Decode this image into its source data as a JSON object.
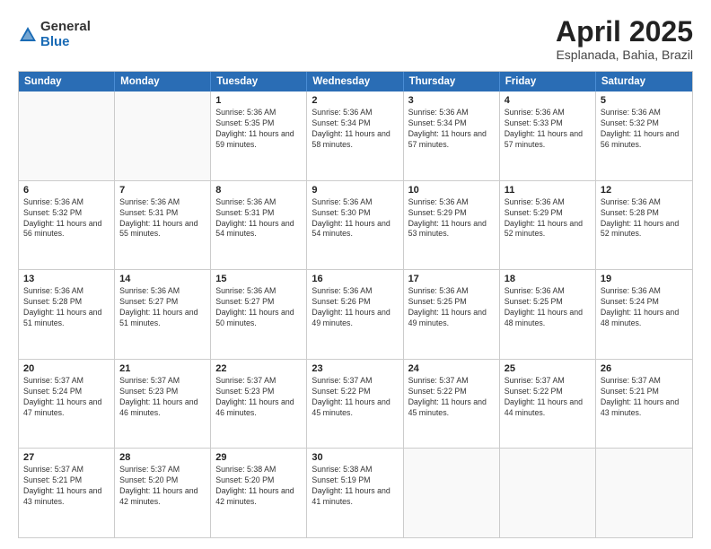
{
  "logo": {
    "general": "General",
    "blue": "Blue"
  },
  "title": "April 2025",
  "location": "Esplanada, Bahia, Brazil",
  "days": [
    "Sunday",
    "Monday",
    "Tuesday",
    "Wednesday",
    "Thursday",
    "Friday",
    "Saturday"
  ],
  "rows": [
    [
      {
        "day": "",
        "sunrise": "",
        "sunset": "",
        "daylight": ""
      },
      {
        "day": "",
        "sunrise": "",
        "sunset": "",
        "daylight": ""
      },
      {
        "day": "1",
        "sunrise": "Sunrise: 5:36 AM",
        "sunset": "Sunset: 5:35 PM",
        "daylight": "Daylight: 11 hours and 59 minutes."
      },
      {
        "day": "2",
        "sunrise": "Sunrise: 5:36 AM",
        "sunset": "Sunset: 5:34 PM",
        "daylight": "Daylight: 11 hours and 58 minutes."
      },
      {
        "day": "3",
        "sunrise": "Sunrise: 5:36 AM",
        "sunset": "Sunset: 5:34 PM",
        "daylight": "Daylight: 11 hours and 57 minutes."
      },
      {
        "day": "4",
        "sunrise": "Sunrise: 5:36 AM",
        "sunset": "Sunset: 5:33 PM",
        "daylight": "Daylight: 11 hours and 57 minutes."
      },
      {
        "day": "5",
        "sunrise": "Sunrise: 5:36 AM",
        "sunset": "Sunset: 5:32 PM",
        "daylight": "Daylight: 11 hours and 56 minutes."
      }
    ],
    [
      {
        "day": "6",
        "sunrise": "Sunrise: 5:36 AM",
        "sunset": "Sunset: 5:32 PM",
        "daylight": "Daylight: 11 hours and 56 minutes."
      },
      {
        "day": "7",
        "sunrise": "Sunrise: 5:36 AM",
        "sunset": "Sunset: 5:31 PM",
        "daylight": "Daylight: 11 hours and 55 minutes."
      },
      {
        "day": "8",
        "sunrise": "Sunrise: 5:36 AM",
        "sunset": "Sunset: 5:31 PM",
        "daylight": "Daylight: 11 hours and 54 minutes."
      },
      {
        "day": "9",
        "sunrise": "Sunrise: 5:36 AM",
        "sunset": "Sunset: 5:30 PM",
        "daylight": "Daylight: 11 hours and 54 minutes."
      },
      {
        "day": "10",
        "sunrise": "Sunrise: 5:36 AM",
        "sunset": "Sunset: 5:29 PM",
        "daylight": "Daylight: 11 hours and 53 minutes."
      },
      {
        "day": "11",
        "sunrise": "Sunrise: 5:36 AM",
        "sunset": "Sunset: 5:29 PM",
        "daylight": "Daylight: 11 hours and 52 minutes."
      },
      {
        "day": "12",
        "sunrise": "Sunrise: 5:36 AM",
        "sunset": "Sunset: 5:28 PM",
        "daylight": "Daylight: 11 hours and 52 minutes."
      }
    ],
    [
      {
        "day": "13",
        "sunrise": "Sunrise: 5:36 AM",
        "sunset": "Sunset: 5:28 PM",
        "daylight": "Daylight: 11 hours and 51 minutes."
      },
      {
        "day": "14",
        "sunrise": "Sunrise: 5:36 AM",
        "sunset": "Sunset: 5:27 PM",
        "daylight": "Daylight: 11 hours and 51 minutes."
      },
      {
        "day": "15",
        "sunrise": "Sunrise: 5:36 AM",
        "sunset": "Sunset: 5:27 PM",
        "daylight": "Daylight: 11 hours and 50 minutes."
      },
      {
        "day": "16",
        "sunrise": "Sunrise: 5:36 AM",
        "sunset": "Sunset: 5:26 PM",
        "daylight": "Daylight: 11 hours and 49 minutes."
      },
      {
        "day": "17",
        "sunrise": "Sunrise: 5:36 AM",
        "sunset": "Sunset: 5:25 PM",
        "daylight": "Daylight: 11 hours and 49 minutes."
      },
      {
        "day": "18",
        "sunrise": "Sunrise: 5:36 AM",
        "sunset": "Sunset: 5:25 PM",
        "daylight": "Daylight: 11 hours and 48 minutes."
      },
      {
        "day": "19",
        "sunrise": "Sunrise: 5:36 AM",
        "sunset": "Sunset: 5:24 PM",
        "daylight": "Daylight: 11 hours and 48 minutes."
      }
    ],
    [
      {
        "day": "20",
        "sunrise": "Sunrise: 5:37 AM",
        "sunset": "Sunset: 5:24 PM",
        "daylight": "Daylight: 11 hours and 47 minutes."
      },
      {
        "day": "21",
        "sunrise": "Sunrise: 5:37 AM",
        "sunset": "Sunset: 5:23 PM",
        "daylight": "Daylight: 11 hours and 46 minutes."
      },
      {
        "day": "22",
        "sunrise": "Sunrise: 5:37 AM",
        "sunset": "Sunset: 5:23 PM",
        "daylight": "Daylight: 11 hours and 46 minutes."
      },
      {
        "day": "23",
        "sunrise": "Sunrise: 5:37 AM",
        "sunset": "Sunset: 5:22 PM",
        "daylight": "Daylight: 11 hours and 45 minutes."
      },
      {
        "day": "24",
        "sunrise": "Sunrise: 5:37 AM",
        "sunset": "Sunset: 5:22 PM",
        "daylight": "Daylight: 11 hours and 45 minutes."
      },
      {
        "day": "25",
        "sunrise": "Sunrise: 5:37 AM",
        "sunset": "Sunset: 5:22 PM",
        "daylight": "Daylight: 11 hours and 44 minutes."
      },
      {
        "day": "26",
        "sunrise": "Sunrise: 5:37 AM",
        "sunset": "Sunset: 5:21 PM",
        "daylight": "Daylight: 11 hours and 43 minutes."
      }
    ],
    [
      {
        "day": "27",
        "sunrise": "Sunrise: 5:37 AM",
        "sunset": "Sunset: 5:21 PM",
        "daylight": "Daylight: 11 hours and 43 minutes."
      },
      {
        "day": "28",
        "sunrise": "Sunrise: 5:37 AM",
        "sunset": "Sunset: 5:20 PM",
        "daylight": "Daylight: 11 hours and 42 minutes."
      },
      {
        "day": "29",
        "sunrise": "Sunrise: 5:38 AM",
        "sunset": "Sunset: 5:20 PM",
        "daylight": "Daylight: 11 hours and 42 minutes."
      },
      {
        "day": "30",
        "sunrise": "Sunrise: 5:38 AM",
        "sunset": "Sunset: 5:19 PM",
        "daylight": "Daylight: 11 hours and 41 minutes."
      },
      {
        "day": "",
        "sunrise": "",
        "sunset": "",
        "daylight": ""
      },
      {
        "day": "",
        "sunrise": "",
        "sunset": "",
        "daylight": ""
      },
      {
        "day": "",
        "sunrise": "",
        "sunset": "",
        "daylight": ""
      }
    ]
  ]
}
